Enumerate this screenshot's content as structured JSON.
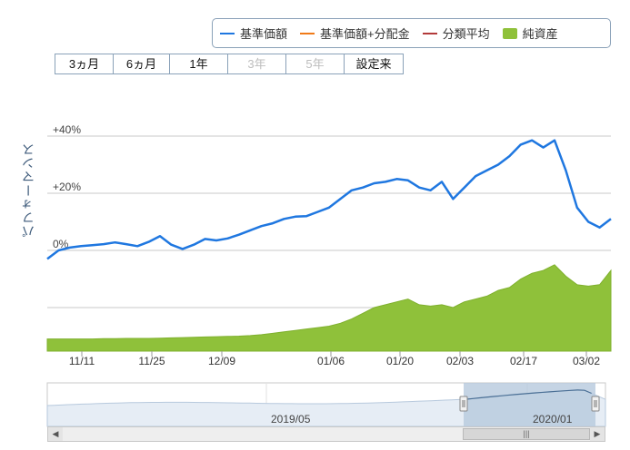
{
  "legend": {
    "items": [
      {
        "label": "基準価額",
        "color": "#1f77e0",
        "kind": "line"
      },
      {
        "label": "基準価額+分配金",
        "color": "#f07a18",
        "kind": "line"
      },
      {
        "label": "分類平均",
        "color": "#b23a3a",
        "kind": "line"
      },
      {
        "label": "純資産",
        "color": "#8fc13a",
        "kind": "box"
      }
    ]
  },
  "range_buttons": [
    {
      "label": "3ヵ月",
      "enabled": true
    },
    {
      "label": "6ヵ月",
      "enabled": true
    },
    {
      "label": "1年",
      "enabled": true
    },
    {
      "label": "3年",
      "enabled": false
    },
    {
      "label": "5年",
      "enabled": false
    },
    {
      "label": "設定来",
      "enabled": true
    }
  ],
  "chart": {
    "ylabel": "パフォーマンス",
    "yticks": [
      "+40%",
      "+20%",
      "0%"
    ],
    "xticks": [
      "11/11",
      "11/25",
      "12/09",
      "01/06",
      "01/20",
      "02/03",
      "02/17",
      "03/02"
    ],
    "navigator_labels": [
      "2019/05",
      "2020/01"
    ],
    "colors": {
      "line": "#1f77e0",
      "area": "#8fc13a",
      "navigator_fill": "#b7c9dd"
    }
  },
  "chart_data": {
    "type": "line",
    "x": [
      "11/01",
      "11/04",
      "11/06",
      "11/08",
      "11/11",
      "11/13",
      "11/15",
      "11/18",
      "11/20",
      "11/22",
      "11/25",
      "11/27",
      "11/29",
      "12/02",
      "12/04",
      "12/06",
      "12/09",
      "12/11",
      "12/13",
      "12/16",
      "12/18",
      "12/20",
      "12/23",
      "12/26",
      "12/30",
      "01/06",
      "01/08",
      "01/10",
      "01/14",
      "01/16",
      "01/20",
      "01/22",
      "01/24",
      "01/27",
      "01/29",
      "01/31",
      "02/03",
      "02/05",
      "02/07",
      "02/10",
      "02/12",
      "02/14",
      "02/17",
      "02/19",
      "02/21",
      "02/25",
      "02/27",
      "03/02",
      "03/04",
      "03/06",
      "03/09"
    ],
    "series": [
      {
        "name": "基準価額",
        "values": [
          -3,
          0,
          1,
          1.5,
          1.8,
          2.2,
          2.8,
          2.2,
          1.5,
          3,
          5,
          2,
          0.5,
          2,
          4,
          3.5,
          4.2,
          5.5,
          7,
          8.5,
          9.5,
          11,
          11.8,
          12,
          13.5,
          15,
          18,
          21,
          22,
          23.5,
          24,
          25,
          24.5,
          22,
          21,
          24,
          18,
          22,
          26,
          28,
          30,
          33,
          37,
          38.5,
          36,
          38.5,
          28,
          15,
          10,
          8,
          11
        ]
      },
      {
        "name": "純資産",
        "values": [
          -31,
          -31,
          -31,
          -31,
          -31,
          -30.9,
          -30.9,
          -30.8,
          -30.8,
          -30.8,
          -30.7,
          -30.6,
          -30.5,
          -30.4,
          -30.3,
          -30.2,
          -30.1,
          -30,
          -29.8,
          -29.5,
          -29,
          -28.5,
          -28,
          -27.5,
          -27,
          -26.5,
          -25.5,
          -24,
          -22,
          -20,
          -19,
          -18,
          -17,
          -19,
          -19.5,
          -19,
          -20,
          -18,
          -17,
          -16,
          -14,
          -13,
          -10,
          -8,
          -7,
          -5,
          -9,
          -12,
          -12.5,
          -12,
          -7
        ]
      }
    ],
    "ylim": [
      -36,
      50
    ],
    "grid": true,
    "legend": "top-right"
  },
  "scrollbar": {
    "left_arrow": "◀",
    "right_arrow": "▶",
    "thumb_grip": "|||"
  }
}
